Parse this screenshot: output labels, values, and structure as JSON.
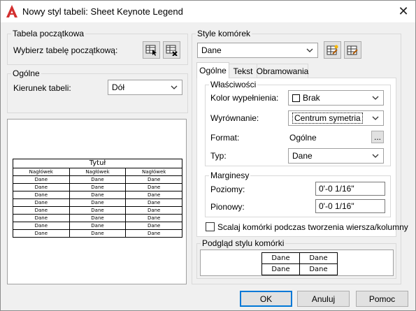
{
  "window": {
    "title": "Nowy styl tabeli: Sheet Keynote Legend",
    "close_symbol": "✕"
  },
  "starting_table": {
    "group_label": "Tabela początkowa",
    "select_label": "Wybierz tabelę początkową:"
  },
  "general": {
    "group_label": "Ogólne",
    "direction_label": "Kierunek tabeli:",
    "direction_value": "Dół"
  },
  "preview": {
    "title": "Tytuł",
    "header": "Nagłówek",
    "data": "Dane"
  },
  "cell_styles": {
    "group_label": "Style komórek",
    "selected": "Dane",
    "tabs": [
      "Ogólne",
      "Tekst",
      "Obramowania"
    ],
    "active_tab": "Ogólne"
  },
  "properties": {
    "group_label": "Właściwości",
    "fill_label": "Kolor wypełnienia:",
    "fill_value": "Brak",
    "align_label": "Wyrównanie:",
    "align_value": "Centrum symetria",
    "format_label": "Format:",
    "format_value": "Ogólne",
    "format_button": "...",
    "type_label": "Typ:",
    "type_value": "Dane"
  },
  "margins": {
    "group_label": "Marginesy",
    "horizontal_label": "Poziomy:",
    "horizontal_value": "0'-0 1/16\"",
    "vertical_label": "Pionowy:",
    "vertical_value": "0'-0 1/16\""
  },
  "merge": {
    "label": "Scalaj komórki podczas tworzenia wiersza/kolumny",
    "checked": false
  },
  "cell_preview": {
    "group_label": "Podgląd stylu komórki",
    "cell_text": "Dane"
  },
  "buttons": {
    "ok": "OK",
    "cancel": "Anuluj",
    "help": "Pomoc"
  },
  "colors": {
    "accent": "#0078d7",
    "app_icon_red": "#d32f2f"
  }
}
